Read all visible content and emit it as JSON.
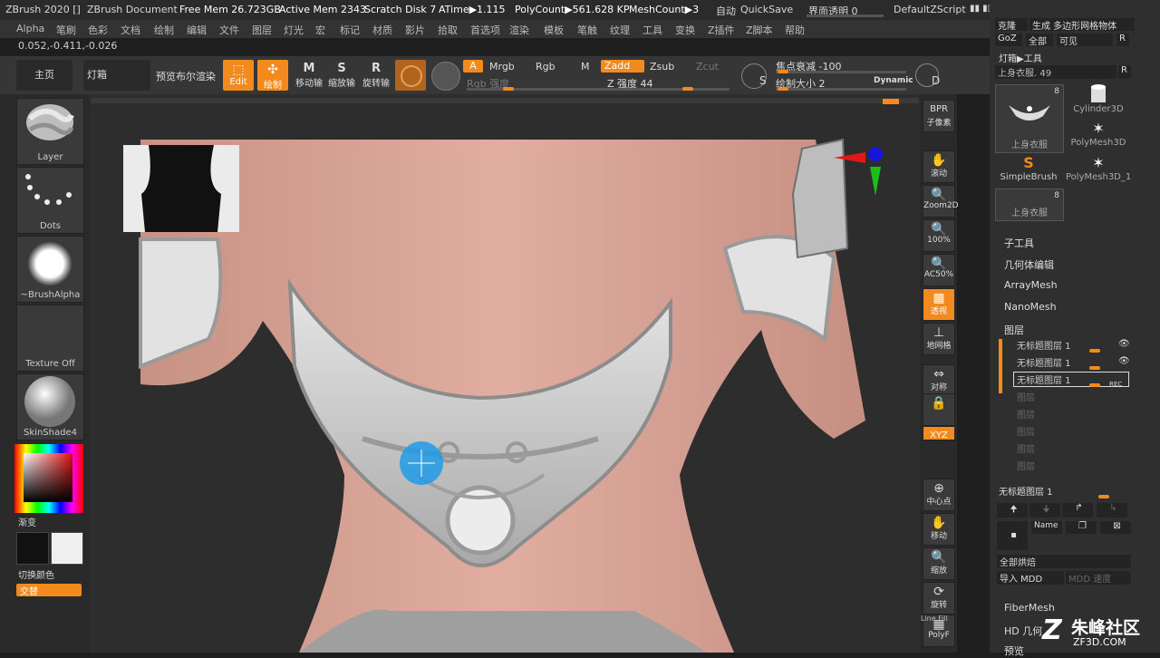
{
  "titlebar": {
    "app": "ZBrush 2020 []",
    "document": "ZBrush Document",
    "free_mem": "Free Mem 26.723GB",
    "active_mem": "Active Mem 2343",
    "scratch": "Scratch Disk 7",
    "atime": "ATime▶1.115",
    "polycount": "PolyCount▶561.628 KP",
    "meshcount": "MeshCount▶3",
    "auto": "自动",
    "quicksave": "QuickSave",
    "transparency": "界面透明 0",
    "script": "DefaultZScript"
  },
  "menu": [
    "Alpha",
    "笔刷",
    "色彩",
    "文档",
    "绘制",
    "编辑",
    "文件",
    "图层",
    "灯光",
    "宏",
    "标记",
    "材质",
    "影片",
    "拾取",
    "首选项",
    "渲染",
    "模板",
    "笔触",
    "纹理",
    "工具",
    "变换",
    "Z插件",
    "Z脚本",
    "帮助"
  ],
  "coords": "0.052,-0.411,-0.026",
  "toolbar": {
    "home": "主页",
    "lightbox": "灯箱",
    "preview_bool": "预览布尔渲染",
    "edit": "Edit",
    "draw": "绘制",
    "move": "移动输",
    "scale": "缩放输",
    "rotate": "旋转输",
    "a": "A",
    "mrgb": "Mrgb",
    "rgb": "Rgb",
    "m": "M",
    "rgb_intensity": "Rgb 强度",
    "zadd": "Zadd",
    "zsub": "Zsub",
    "zcut": "Zcut",
    "z_intensity": "Z 强度 44",
    "s_label": "S",
    "focal": "焦点衰减 -100",
    "draw_size": "绘制大小 2",
    "dynamic": "Dynamic",
    "d_label": "D"
  },
  "left": {
    "brush": "Layer",
    "stroke": "Dots",
    "alpha": "~BrushAlpha",
    "texture": "Texture Off",
    "material": "SkinShade4",
    "gradient": "渐变",
    "switch_color": "切换颜色",
    "alternate": "交替"
  },
  "right_shelf": [
    {
      "id": "bpr",
      "icon": "BPR",
      "label": "子像素"
    },
    {
      "id": "scroll",
      "icon": "✋",
      "label": "滚动"
    },
    {
      "id": "zoom2d",
      "icon": "🔍",
      "label": "Zoom2D"
    },
    {
      "id": "p100",
      "icon": "🔍",
      "label": "100%"
    },
    {
      "id": "ac50",
      "icon": "🔍",
      "label": "AC50%"
    },
    {
      "id": "persp",
      "icon": "▦",
      "label": "透视"
    },
    {
      "id": "floor",
      "icon": "⊥",
      "label": "地网格"
    },
    {
      "id": "sym",
      "icon": "⇔",
      "label": "对称"
    },
    {
      "id": "lock",
      "icon": "🔒",
      "label": ""
    },
    {
      "id": "xyz",
      "icon": "XYZ",
      "label": ""
    },
    {
      "id": "center",
      "icon": "⊕",
      "label": "中心点"
    },
    {
      "id": "move",
      "icon": "✋",
      "label": "移动"
    },
    {
      "id": "scale",
      "icon": "🔍",
      "label": "缩放"
    },
    {
      "id": "rotate",
      "icon": "⟳",
      "label": "旋转"
    },
    {
      "id": "polyf",
      "icon": "▦",
      "label": "PolyF"
    }
  ],
  "right_shelf_extra": {
    "line_fill": "Line Fill"
  },
  "palette": {
    "clone": "克隆",
    "make_polymesh": "生成 多边形网格物体",
    "goz": "GoZ",
    "all": "全部",
    "visible": "可见",
    "r": "R",
    "lightbox_tool": "灯箱▶工具",
    "current_tool": "上身衣服. 49",
    "thumbs": [
      {
        "name": "上身衣服",
        "count": "8"
      },
      {
        "name": "Cylinder3D",
        "count": ""
      },
      {
        "name": "PolyMesh3D",
        "count": ""
      },
      {
        "name": "SimpleBrush",
        "count": ""
      },
      {
        "name": "PolyMesh3D_1",
        "count": ""
      },
      {
        "name": "上身衣服",
        "count": "8"
      }
    ],
    "subtool": "子工具",
    "geometry": "几何体编辑",
    "arraymesh": "ArrayMesh",
    "nanomesh": "NanoMesh",
    "layers": "图层",
    "layer_rows": [
      "无标题图层 1",
      "无标题图层 1",
      "无标题图层 1"
    ],
    "rec": "REC",
    "empty_layer": "图层",
    "layer_bottom": "无标题图层 1",
    "name_btn": "Name",
    "bake_all": "全部烘焙",
    "import_mdd": "导入 MDD",
    "mdd_speed": "MDD 速度",
    "fibermesh": "FiberMesh",
    "hd_geometry": "HD 几何",
    "preview": "预览"
  },
  "watermark": {
    "brand": "朱峰社区",
    "url": "ZF3D.COM"
  },
  "colors": {
    "accent": "#f28a1e",
    "skin": "#d7a396",
    "armor": "#d4d4d4",
    "brush_cursor": "#1e9be6"
  }
}
